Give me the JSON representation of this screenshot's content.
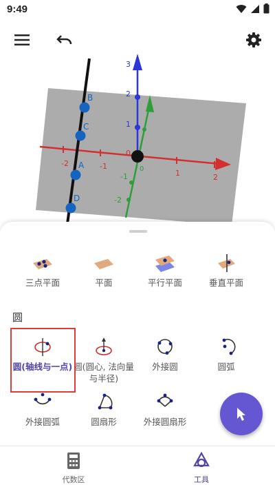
{
  "status_bar": {
    "time": "9:49"
  },
  "toolbar": {
    "menu": "menu-icon",
    "undo": "undo-icon",
    "settings": "gear-icon"
  },
  "graphics": {
    "x_ticks": [
      "-2",
      "-1",
      "0",
      "1",
      "2"
    ],
    "y_ticks": [
      "-2",
      "-1",
      "0"
    ],
    "z_ticks": [
      "1",
      "2",
      "3"
    ],
    "points": [
      "A",
      "B",
      "C",
      "D"
    ],
    "colors": {
      "x_axis": "#d32f2f",
      "y_axis": "#2e9e3a",
      "z_axis": "#2b37d8",
      "line": "#111111",
      "point": "#1565c0"
    }
  },
  "panel": {
    "plane_tools": [
      {
        "label": "三点平面",
        "icon": "plane-three-points-icon"
      },
      {
        "label": "平面",
        "icon": "plane-icon"
      },
      {
        "label": "平行平面",
        "icon": "parallel-plane-icon"
      },
      {
        "label": "垂直平面",
        "icon": "perpendicular-plane-icon"
      }
    ],
    "section_title": "圆",
    "circle_tools": [
      {
        "label": "圆(轴线与一点)",
        "icon": "circle-axis-point-icon"
      },
      {
        "label": "圆(圆心, 法向量与半径)",
        "icon": "circle-center-direction-radius-icon"
      },
      {
        "label": "外接圆",
        "icon": "circumcircle-icon"
      },
      {
        "label": "圆弧",
        "icon": "circular-arc-icon"
      },
      {
        "label": "外接圆弧",
        "icon": "circumcircular-arc-icon"
      },
      {
        "label": "圆扇形",
        "icon": "circular-sector-icon"
      },
      {
        "label": "外接圆扇形",
        "icon": "circumcircular-sector-icon"
      }
    ]
  },
  "bottom_nav": [
    {
      "label": "代数区",
      "icon": "calculator-icon"
    },
    {
      "label": "工具",
      "icon": "tools-icon"
    }
  ],
  "accent_color": "#6557d2"
}
